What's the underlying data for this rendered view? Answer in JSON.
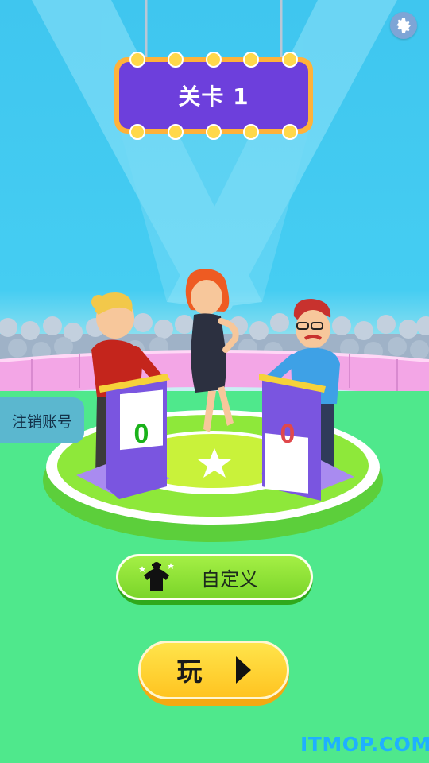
{
  "level": {
    "label": "关卡 1"
  },
  "account": {
    "delete_label": "注销账号"
  },
  "scoreboards": {
    "left_score": "0",
    "right_score": "0"
  },
  "buttons": {
    "customize_label": "自定义",
    "play_label": "玩"
  },
  "watermark": "ITMOP.COM",
  "icons": {
    "settings": "gear-icon",
    "customize": "outfit-icon",
    "play": "play-triangle-icon"
  },
  "colors": {
    "sky": "#45cdf2",
    "sign_purple": "#6d3fdc",
    "sign_frame": "#ffb23a",
    "customize_green": "#8be236",
    "play_yellow": "#ffd22e",
    "left_score_color": "#1ab21a",
    "right_score_color": "#e0484c"
  }
}
